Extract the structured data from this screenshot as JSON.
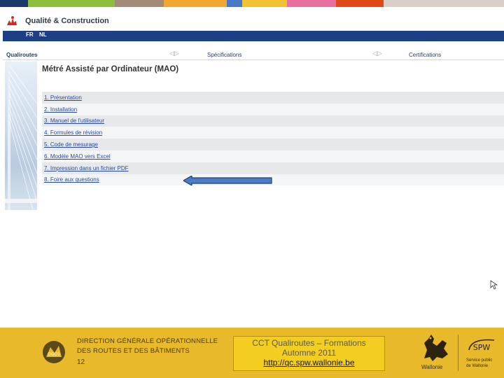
{
  "header": {
    "site_title": "Qualité & Construction",
    "languages": [
      "FR",
      "NL"
    ]
  },
  "nav": {
    "items": [
      "Qualiroutes",
      "Spécifications",
      "Certifications"
    ]
  },
  "page": {
    "heading": "Métré Assisté par Ordinateur (MAO)"
  },
  "menu": {
    "items": [
      "1. Présentation",
      "2. Installation",
      "3. Manuel de l'utilisateur",
      "4. Formules de révision",
      "5. Code de mesurage",
      "6. Modèle MAO vers Excel",
      "7. Impression dans un fichier PDF",
      "8. Foire aux questions"
    ]
  },
  "footer": {
    "direction_line1": "DIRECTION GÉNÉRALE OPÉRATIONNELLE",
    "direction_line2": "DES ROUTES ET DES BÂTIMENTS",
    "page_number": "12",
    "info_line1": "CCT Qualiroutes – Formations",
    "info_line2": "Automne 2011",
    "info_link": "http://qc.spw.wallonie.be",
    "wallonie_label": "Wallonie",
    "spw_label": "SPW",
    "spw_sub1": "Service public",
    "spw_sub2": "de Wallonie"
  },
  "colors": {
    "strip": [
      "#1a3a6b",
      "#8bbf3a",
      "#a48a78",
      "#f0a830",
      "#4a78c8",
      "#f2c230",
      "#e870a0",
      "#e04818",
      "#d8d0c8"
    ],
    "lang_bar": "#1d3f85",
    "footer": "#e8b92a",
    "info_box": "#f3cd1f",
    "link": "#2a4aa0"
  }
}
